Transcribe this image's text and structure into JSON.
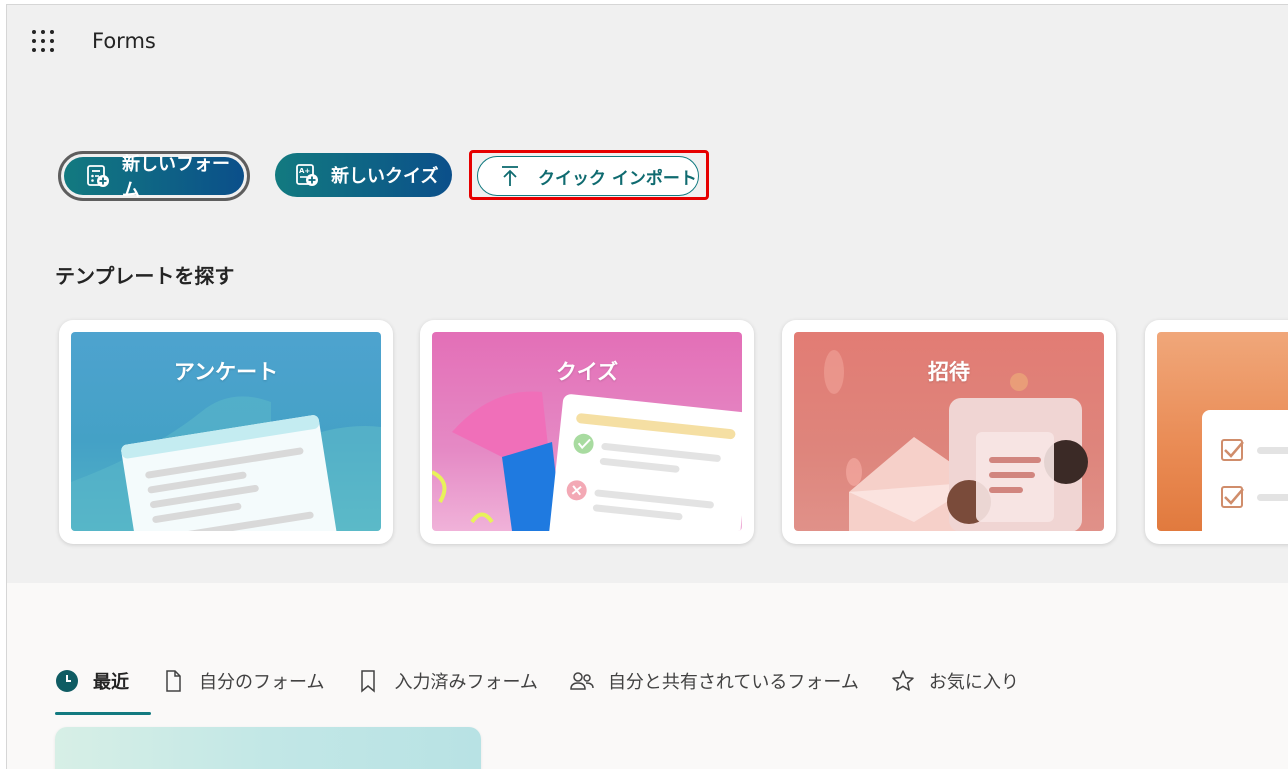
{
  "header": {
    "app_title": "Forms"
  },
  "actions": {
    "new_form": "新しいフォーム",
    "new_quiz": "新しいクイズ",
    "quick_import": "クイック インポート"
  },
  "templates": {
    "section_title": "テンプレートを探す",
    "cards": [
      {
        "title": "アンケート",
        "color": "#4aa6c9"
      },
      {
        "title": "クイズ",
        "color": "#e07bb8"
      },
      {
        "title": "招待",
        "color": "#e0837a"
      },
      {
        "title": "",
        "color": "#e98a53"
      }
    ]
  },
  "tabs": [
    {
      "label": "最近",
      "icon": "clock-icon",
      "active": true
    },
    {
      "label": "自分のフォーム",
      "icon": "document-icon",
      "active": false
    },
    {
      "label": "入力済みフォーム",
      "icon": "bookmark-icon",
      "active": false
    },
    {
      "label": "自分と共有されているフォーム",
      "icon": "people-icon",
      "active": false
    },
    {
      "label": "お気に入り",
      "icon": "star-icon",
      "active": false
    }
  ],
  "colors": {
    "accent": "#127a80",
    "highlight_box": "#e60000"
  }
}
